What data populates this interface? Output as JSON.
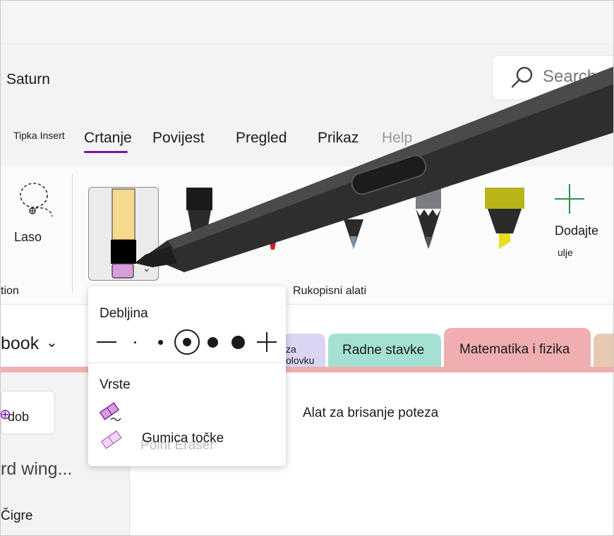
{
  "window": {
    "title": "Saturn"
  },
  "search": {
    "placeholder": "Search"
  },
  "tabs": [
    {
      "label": "Tipka Insert",
      "small": true
    },
    {
      "label": "Crtanje",
      "active": true
    },
    {
      "label": "Povijest"
    },
    {
      "label": "Pregled"
    },
    {
      "label": "Prikaz"
    },
    {
      "label": "Help"
    }
  ],
  "ribbon": {
    "lasso_label": "Laso",
    "left_group_label": "tion",
    "group_label": "Rukopisni alati",
    "add_label": "Dodajte",
    "add_sublabel": "ulje",
    "accent_color": "#7719aa"
  },
  "notebook": {
    "name": "book",
    "add_page_label": "dob",
    "pages": [
      "rd wing...",
      "Čigre"
    ]
  },
  "sections": [
    {
      "label": "za olovku",
      "color": "#d9d5f3"
    },
    {
      "label": "Radne stavke",
      "color": "#a5e1d2"
    },
    {
      "label": "Matematika i fizika",
      "color": "#f0aeb0",
      "active": true
    },
    {
      "label": "",
      "color": "#e6c9b3"
    }
  ],
  "note": {
    "text": "Alat za brisanje poteza"
  },
  "eraser_menu": {
    "thickness_label": "Debljina",
    "types_label": "Vrste",
    "types": [
      {
        "label": "",
        "icon": "stroke-eraser-icon"
      },
      {
        "label": "Gumica točke",
        "icon": "point-eraser-icon"
      }
    ],
    "ghost_label": "Point Eraser"
  }
}
